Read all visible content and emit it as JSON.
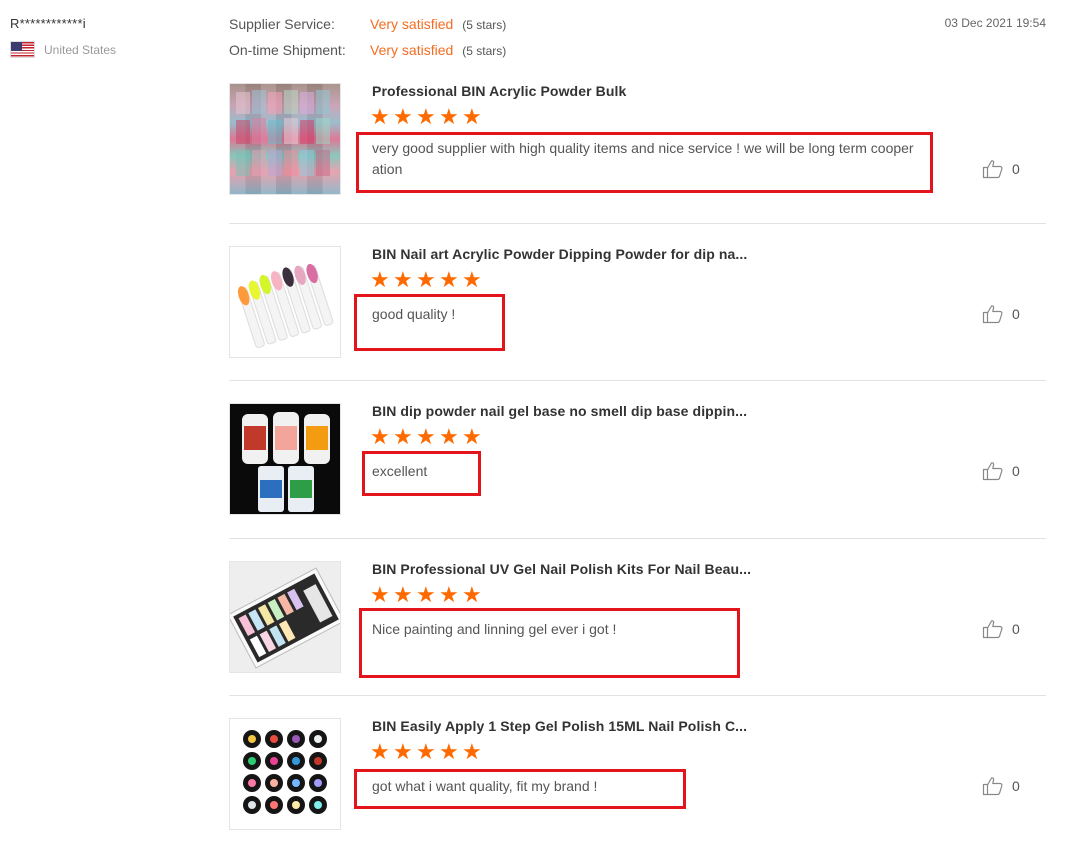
{
  "buyer": {
    "name": "R************i",
    "country": "United States",
    "flag_icon": "us-flag-icon"
  },
  "ratings": [
    {
      "label": "Supplier Service:",
      "value": "Very satisfied",
      "stars": "(5 stars)"
    },
    {
      "label": "On-time Shipment:",
      "value": "Very satisfied",
      "stars": "(5 stars)"
    }
  ],
  "review_date": "03 Dec 2021 19:54",
  "colors": {
    "accent": "#f36c21",
    "star": "#ff6a00",
    "highlight_box": "#e3141c"
  },
  "items": [
    {
      "title": "Professional BIN Acrylic Powder Bulk",
      "star_count": 5,
      "review": "very good supplier with high quality items and nice service ! we will be long term cooperation",
      "helpful_count": "0",
      "image": "acrylic-powder-bags-image"
    },
    {
      "title": "BIN Nail art Acrylic Powder Dipping Powder for dip na...",
      "star_count": 5,
      "review": "good quality !",
      "helpful_count": "0",
      "image": "nail-tips-display-image"
    },
    {
      "title": "BIN dip powder nail gel base no smell dip base dippin...",
      "star_count": 5,
      "review": "excellent",
      "helpful_count": "0",
      "image": "dip-liquid-bottles-image"
    },
    {
      "title": "BIN Professional UV Gel Nail Polish Kits For Nail Beau...",
      "star_count": 5,
      "review": "Nice painting and linning gel ever i got !",
      "helpful_count": "0",
      "image": "gel-polish-kit-box-image"
    },
    {
      "title": "BIN Easily Apply 1 Step Gel Polish 15ML Nail Polish C...",
      "star_count": 5,
      "review": "got what i want quality, fit my brand !",
      "helpful_count": "0",
      "image": "gel-polish-bottles-image"
    }
  ]
}
